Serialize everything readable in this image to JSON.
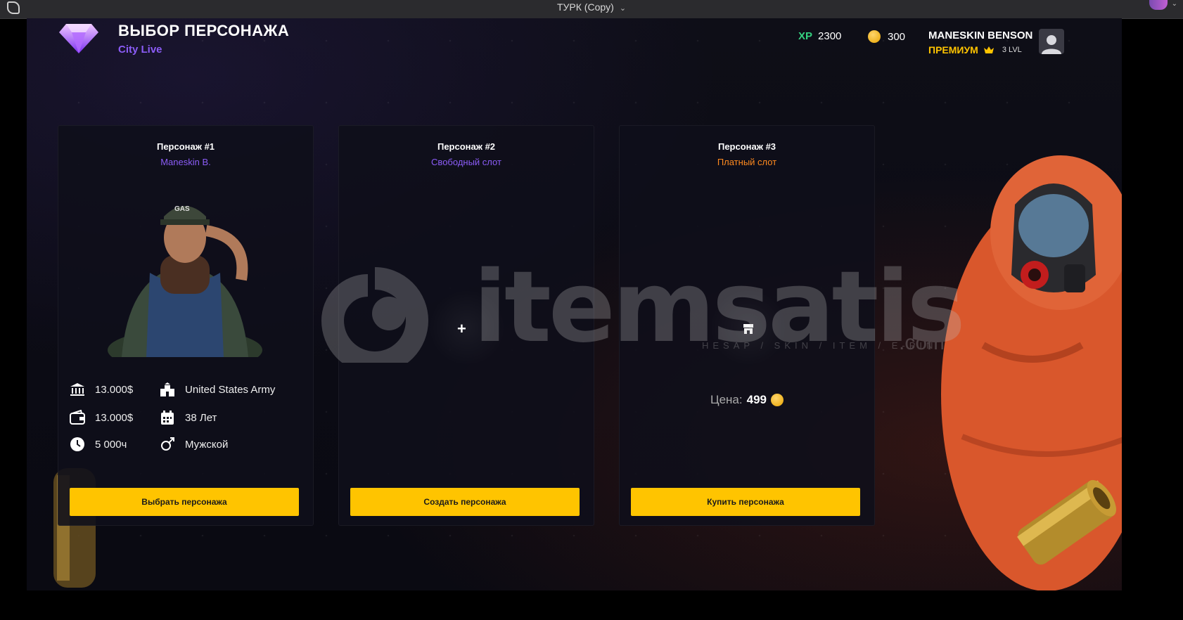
{
  "window": {
    "title": "ТУРК (Copy)"
  },
  "header": {
    "title": "ВЫБОР ПЕРСОНАЖА",
    "subtitle": "City Live",
    "xp_label": "XP",
    "xp_value": "2300",
    "coins": "300",
    "username": "MANESKIN BENSON",
    "premium_label": "ПРЕМИУМ",
    "level": "3 LVL"
  },
  "cards": [
    {
      "title": "Персонаж #1",
      "subtitle": "Maneskin B.",
      "stats": {
        "bank": "13.000$",
        "cash": "13.000$",
        "hours": "5 000ч",
        "faction": "United States Army",
        "age": "38 Лет",
        "gender": "Мужской"
      },
      "button": "Выбрать персонажа"
    },
    {
      "title": "Персонаж #2",
      "subtitle": "Свободный слот",
      "plus": "+",
      "button": "Создать персонажа"
    },
    {
      "title": "Персонаж #3",
      "subtitle": "Платный слот",
      "price_label": "Цена:",
      "price_value": "499",
      "button": "Купить персонажа"
    }
  ],
  "watermark": {
    "brand": "itemsatis",
    "tagline": "HESAP / SKIN / ITEM / E-PIN",
    "domain": ".com"
  },
  "colors": {
    "accent_yellow": "#ffc400",
    "accent_purple": "#8b5cf6",
    "accent_orange": "#ff8a1f",
    "xp_green": "#35d07f"
  }
}
